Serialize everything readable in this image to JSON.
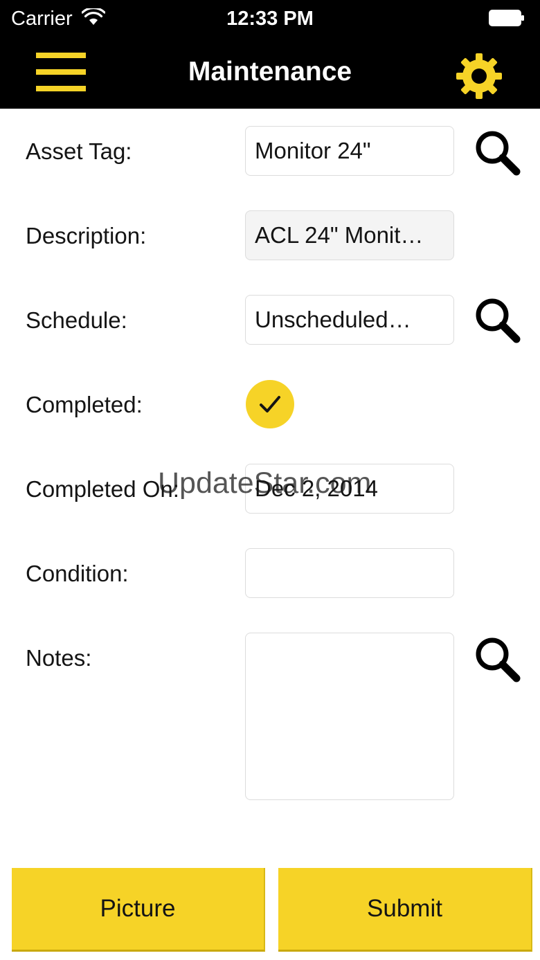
{
  "status_bar": {
    "carrier": "Carrier",
    "time": "12:33 PM",
    "icons": [
      "wifi-icon",
      "battery-icon"
    ]
  },
  "header": {
    "title": "Maintenance",
    "menu_icon": "hamburger-menu-icon",
    "settings_icon": "gear-icon",
    "accent_color": "#f6d327",
    "background_color": "#000000"
  },
  "form": {
    "asset_tag": {
      "label": "Asset Tag:",
      "value": "Monitor 24\"",
      "search_icon": "search-icon"
    },
    "description": {
      "label": "Description:",
      "value": "ACL 24\" Monit…"
    },
    "schedule": {
      "label": "Schedule:",
      "value": "Unscheduled…",
      "search_icon": "search-icon"
    },
    "completed": {
      "label": "Completed:",
      "checked": true,
      "check_icon": "checkmark-icon"
    },
    "completed_on": {
      "label": "Completed On:",
      "value": "Dec 2, 2014"
    },
    "condition": {
      "label": "Condition:",
      "value": ""
    },
    "notes": {
      "label": "Notes:",
      "value": "",
      "search_icon": "search-icon"
    }
  },
  "actions": {
    "picture_label": "Picture",
    "submit_label": "Submit"
  },
  "watermark": {
    "text": "UpdateStar.com"
  }
}
